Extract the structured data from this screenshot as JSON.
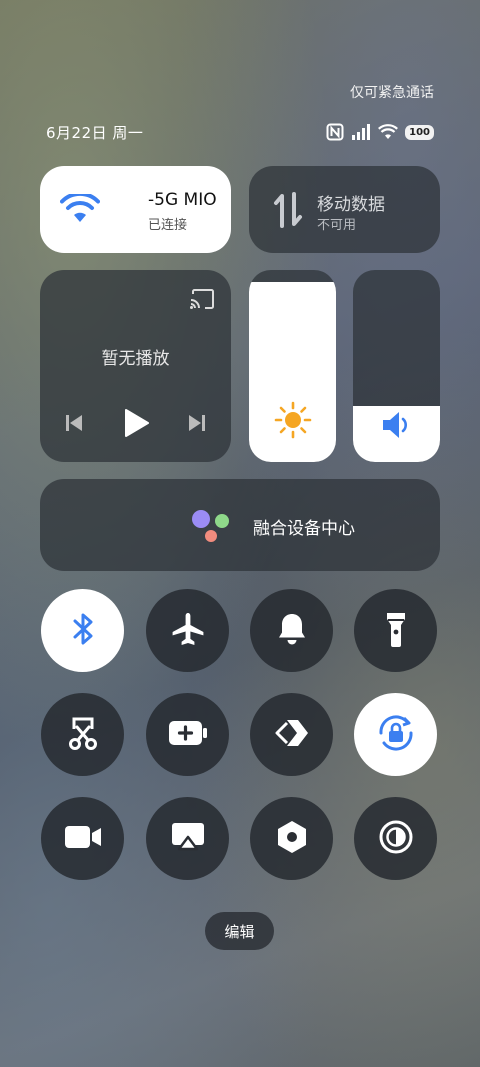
{
  "status": {
    "emergency_text": "仅可紧急通话",
    "date": "6月22日 周一",
    "battery": "100"
  },
  "wifi": {
    "name": "-5G    MIO",
    "status": "已连接",
    "active": true
  },
  "mobile_data": {
    "name": "移动数据",
    "status": "不可用",
    "active": false
  },
  "media": {
    "label": "暂无播放"
  },
  "brightness": {
    "level": 0.94
  },
  "volume": {
    "level": 0.29
  },
  "fusion": {
    "label": "融合设备中心"
  },
  "toggles": [
    {
      "name": "bluetooth",
      "icon": "bluetooth-icon",
      "active": true
    },
    {
      "name": "airplane",
      "icon": "airplane-icon",
      "active": false
    },
    {
      "name": "ring",
      "icon": "bell-icon",
      "active": false
    },
    {
      "name": "flashlight",
      "icon": "flashlight-icon",
      "active": false
    },
    {
      "name": "screenshot",
      "icon": "screenshot-scissors-icon",
      "active": false
    },
    {
      "name": "power-saving",
      "icon": "battery-saver-icon",
      "active": false
    },
    {
      "name": "link",
      "icon": "link-icon",
      "active": false
    },
    {
      "name": "rotation-lock",
      "icon": "rotation-lock-icon",
      "active": true
    },
    {
      "name": "screen-record",
      "icon": "video-camera-icon",
      "active": false
    },
    {
      "name": "screen-cast",
      "icon": "cast-screen-icon",
      "active": false
    },
    {
      "name": "settings",
      "icon": "hexagon-settings-icon",
      "active": false
    },
    {
      "name": "dark-mode",
      "icon": "dark-mode-icon",
      "active": false
    }
  ],
  "edit_label": "编辑",
  "colors": {
    "accent": "#3b7ff0",
    "sun": "#f5a623"
  }
}
